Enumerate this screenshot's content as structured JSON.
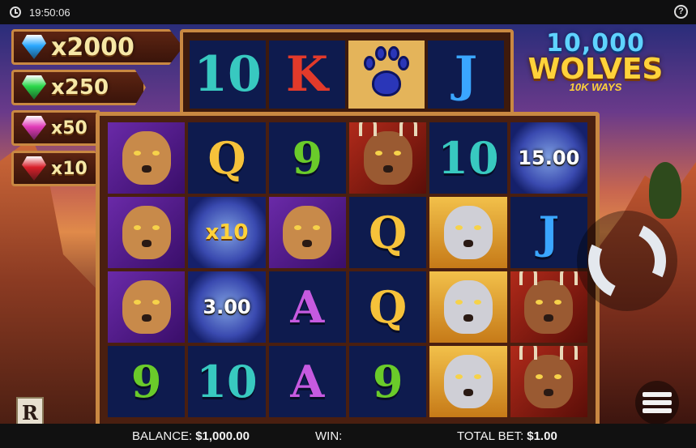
{
  "status_bar": {
    "time": "19:50:06"
  },
  "logo": {
    "line1": "10,000",
    "line2": "WOLVES",
    "line3": "10K WAYS"
  },
  "multipliers": [
    {
      "value": "x2000",
      "gem": "diamond-icon",
      "color": "#2aa8ff"
    },
    {
      "value": "x250",
      "gem": "emerald-icon",
      "color": "#2ad84a"
    },
    {
      "value": "x50",
      "gem": "amethyst-icon",
      "color": "#e23ab8"
    },
    {
      "value": "x10",
      "gem": "ruby-icon",
      "color": "#d8202a"
    }
  ],
  "top_reel": [
    {
      "symbol": "10",
      "cls": "c-10"
    },
    {
      "symbol": "K",
      "cls": "c-K"
    },
    {
      "symbol": "paw",
      "cls": ""
    },
    {
      "symbol": "J",
      "cls": "c-J"
    }
  ],
  "grid": [
    [
      {
        "type": "puma"
      },
      {
        "type": "glyph",
        "text": "Q",
        "cls": "c-Q"
      },
      {
        "type": "glyph",
        "text": "9",
        "cls": "c-9"
      },
      {
        "type": "deer"
      },
      {
        "type": "glyph",
        "text": "10",
        "cls": "c-10"
      },
      {
        "type": "moon",
        "text": "15.00"
      }
    ],
    [
      {
        "type": "puma"
      },
      {
        "type": "moon",
        "text": "x10",
        "gold": true
      },
      {
        "type": "puma"
      },
      {
        "type": "glyph",
        "text": "Q",
        "cls": "c-Q"
      },
      {
        "type": "wolf"
      },
      {
        "type": "glyph",
        "text": "J",
        "cls": "c-J"
      }
    ],
    [
      {
        "type": "puma"
      },
      {
        "type": "moon",
        "text": "3.00"
      },
      {
        "type": "glyph",
        "text": "A",
        "cls": "c-A"
      },
      {
        "type": "glyph",
        "text": "Q",
        "cls": "c-Q"
      },
      {
        "type": "wolf"
      },
      {
        "type": "deer"
      }
    ],
    [
      {
        "type": "glyph",
        "text": "9",
        "cls": "c-9"
      },
      {
        "type": "glyph",
        "text": "10",
        "cls": "c-10"
      },
      {
        "type": "glyph",
        "text": "A",
        "cls": "c-A"
      },
      {
        "type": "glyph",
        "text": "9",
        "cls": "c-9"
      },
      {
        "type": "wolf"
      },
      {
        "type": "deer"
      }
    ]
  ],
  "brand": {
    "letter": "R"
  },
  "footer": {
    "balance_label": "BALANCE:",
    "balance_value": "$1,000.00",
    "win_label": "WIN:",
    "win_value": "",
    "total_bet_label": "TOTAL BET:",
    "total_bet_value": "$1.00"
  }
}
